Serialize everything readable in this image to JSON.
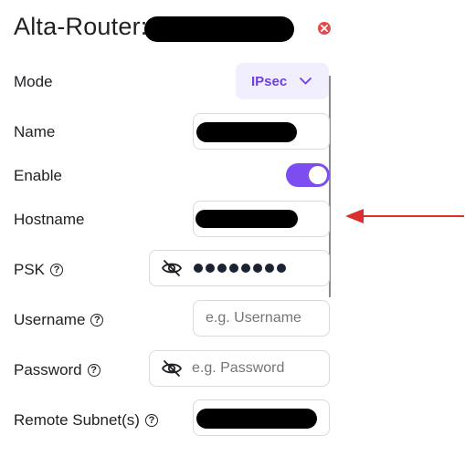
{
  "header": {
    "title": "Alta-Router:"
  },
  "fields": {
    "mode": {
      "label": "Mode",
      "value": "IPsec"
    },
    "name": {
      "label": "Name"
    },
    "enable": {
      "label": "Enable",
      "on": true
    },
    "hostname": {
      "label": "Hostname"
    },
    "psk": {
      "label": "PSK",
      "masked_dots": 8
    },
    "username": {
      "label": "Username",
      "placeholder": "e.g. Username"
    },
    "password": {
      "label": "Password",
      "placeholder": "e.g. Password"
    },
    "remote_subnets": {
      "label": "Remote Subnet(s)"
    }
  },
  "help_glyph": "?",
  "icons": {
    "close": "close-circle-icon",
    "dropdown": "chevron-down-icon",
    "visibility": "eye-off-icon"
  },
  "colors": {
    "accent": "#7c4df0",
    "select_bg": "#f1eefe",
    "close": "#e5484d",
    "annotation_arrow": "#dd2e2e"
  }
}
